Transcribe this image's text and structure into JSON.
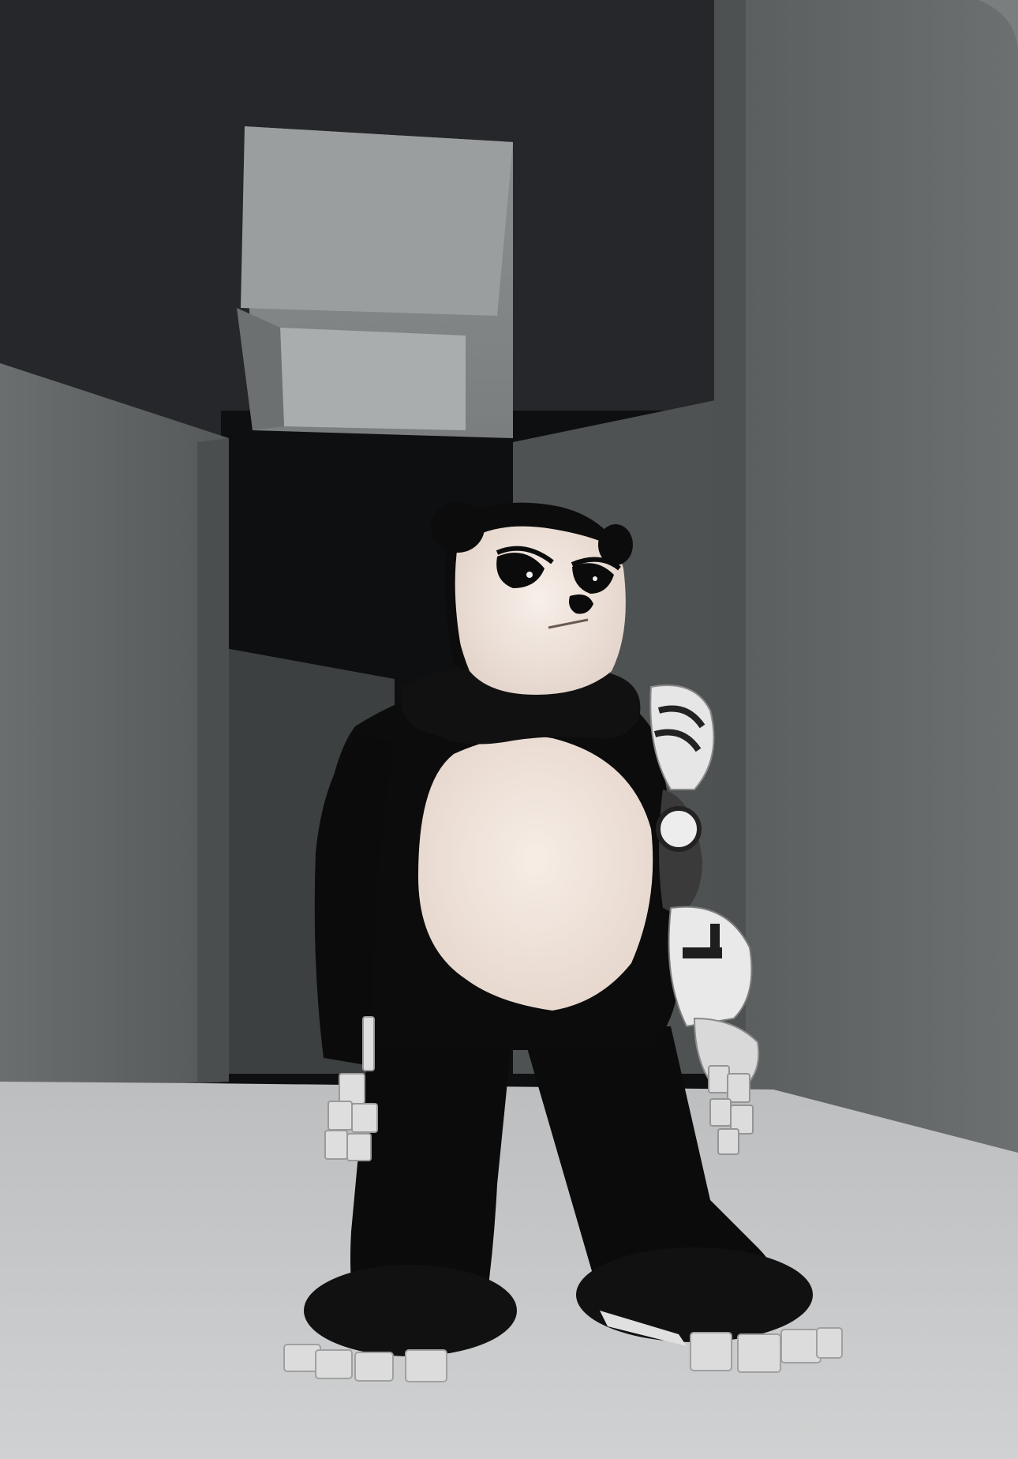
{
  "scene": {
    "type": "3d-game-avatar-preview",
    "colors": {
      "sky_dark": "#202224",
      "wall_gray": "#5e6262",
      "floor_light": "#c4c6c7",
      "fur_black": "#0b0b0b",
      "panda_cream": "#efe4dc",
      "armor_white": "#e4e4e4"
    },
    "character": {
      "description_icon": "panda-avatar",
      "accessories": [
        "robot-arm",
        "robot-hands",
        "robot-toes"
      ]
    }
  }
}
